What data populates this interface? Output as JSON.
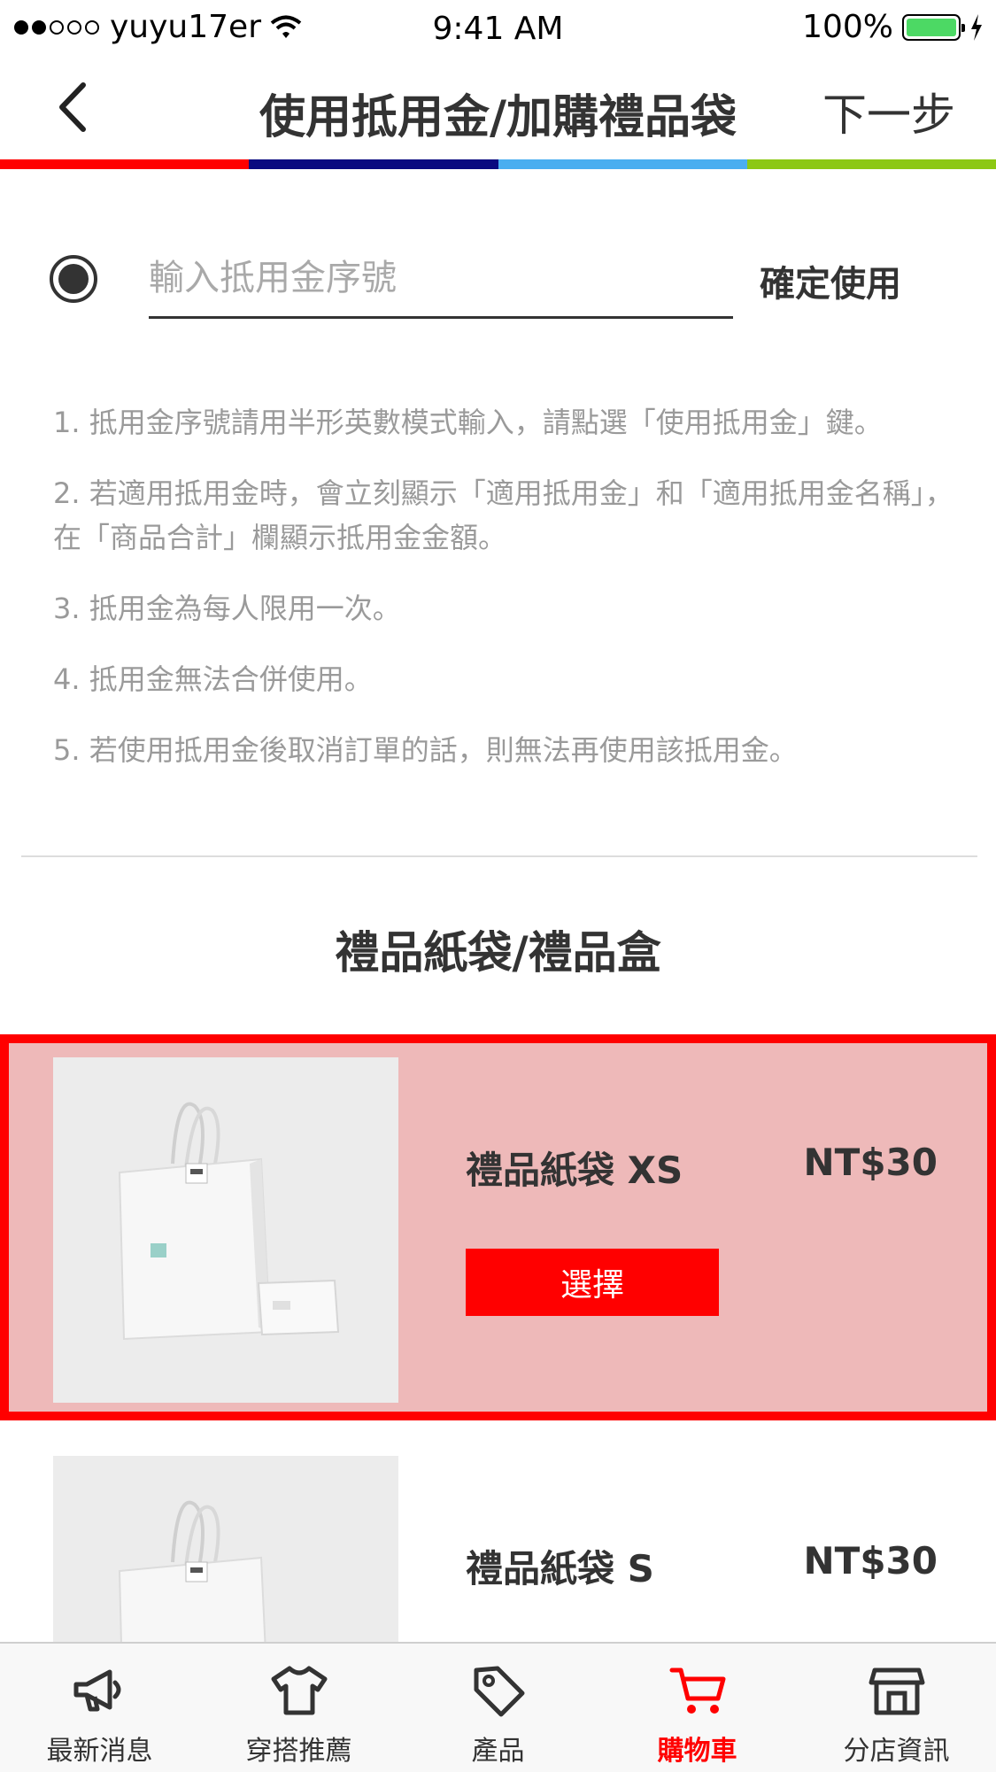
{
  "status_bar": {
    "carrier": "yuyu17er",
    "time": "9:41 AM",
    "battery": "100%"
  },
  "navbar": {
    "title": "使用抵用金/加購禮品袋",
    "next_label": "下一步"
  },
  "progress_colors": [
    "#ff0000",
    "#0a0a80",
    "#4aaef0",
    "#8cc814"
  ],
  "coupon": {
    "placeholder": "輸入抵用金序號",
    "value": "",
    "confirm_label": "確定使用"
  },
  "notes": [
    "1. 抵用金序號請用半形英數模式輸入，請點選「使用抵用金」鍵。",
    "2. 若適用抵用金時，會立刻顯示「適用抵用金」和「適用抵用金名稱」，在「商品合計」欄顯示抵用金金額。",
    "3. 抵用金為每人限用一次。",
    "4. 抵用金無法合併使用。",
    "5. 若使用抵用金後取消訂單的話，則無法再使用該抵用金。"
  ],
  "section_title": "禮品紙袋/禮品盒",
  "products": [
    {
      "name": "禮品紙袋 XS",
      "price": "NT$30",
      "select_label": "選擇",
      "selected": true
    },
    {
      "name": "禮品紙袋 S",
      "price": "NT$30",
      "selected": false
    }
  ],
  "tabs": [
    {
      "label": "最新消息",
      "icon": "megaphone-icon",
      "active": false
    },
    {
      "label": "穿搭推薦",
      "icon": "tshirt-icon",
      "active": false
    },
    {
      "label": "產品",
      "icon": "tag-icon",
      "active": false
    },
    {
      "label": "購物車",
      "icon": "cart-icon",
      "active": true
    },
    {
      "label": "分店資訊",
      "icon": "store-icon",
      "active": false
    }
  ],
  "colors": {
    "accent": "#ff0000",
    "selected_bg": "#eeb9b9",
    "text": "#333333",
    "muted": "#9a9a9a"
  }
}
